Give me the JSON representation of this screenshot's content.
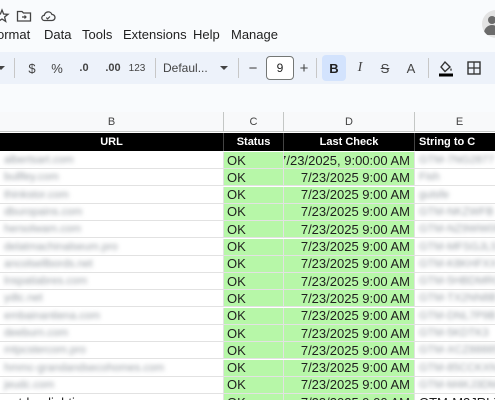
{
  "menu": {
    "items": [
      "ormat",
      "Data",
      "Tools",
      "Extensions",
      "Help",
      "Manage"
    ]
  },
  "toolbar": {
    "currency": "$",
    "percent": "%",
    "decrease_decimal": ".0",
    "increase_decimal": ".00",
    "number_format": "123",
    "font_name": "Defaul...",
    "font_size": "9",
    "minus": "−",
    "plus": "+",
    "bold": "B",
    "italic": "I",
    "strike": "S",
    "text_color": "A"
  },
  "columns": {
    "B": "B",
    "C": "C",
    "D": "D",
    "E": "E"
  },
  "header_row": {
    "url": "URL",
    "status": "Status",
    "last_check": "Last Check",
    "string_to": "String to C"
  },
  "rows": [
    {
      "url": "albertsart.com",
      "status": "OK",
      "last_check": "7/23/2025, 9:00:00 AM",
      "string": "GTM-7NG2877"
    },
    {
      "url": "bullfey.com",
      "status": "OK",
      "last_check": "7/23/2025 9:00 AM",
      "string": "Fish"
    },
    {
      "url": "thinkstor.com",
      "status": "OK",
      "last_check": "7/23/2025 9:00 AM",
      "string": "gutsfe"
    },
    {
      "url": "dburopains.com",
      "status": "OK",
      "last_check": "7/23/2025 9:00 AM",
      "string": "GTM-NKZWFB"
    },
    {
      "url": "hersolwam.com",
      "status": "OK",
      "last_check": "7/23/2025 9:00 AM",
      "string": "GTM-NZ9WW09"
    },
    {
      "url": "delatmachinalseum.pro",
      "status": "OK",
      "last_check": "7/23/2025 9:00 AM",
      "string": "GTM-MFSGJLS"
    },
    {
      "url": "ancolsellbords.net",
      "status": "OK",
      "last_check": "7/23/2025 9:00 AM",
      "string": "GTM-K8KHFXX"
    },
    {
      "url": "lnspatiabres.com",
      "status": "OK",
      "last_check": "7/23/2025 9:00 AM",
      "string": "GTM-5HBDMRC"
    },
    {
      "url": "ydtc.net",
      "status": "OK",
      "last_check": "7/23/2025 9:00 AM",
      "string": "GTM-TX2NN8B"
    },
    {
      "url": "embainantiena.com",
      "status": "OK",
      "last_check": "7/23/2025 9:00 AM",
      "string": "GTM-DNL7P9B"
    },
    {
      "url": "deeburn.com",
      "status": "OK",
      "last_check": "7/23/2025 9:00 AM",
      "string": "GTM-5KDTK3"
    },
    {
      "url": "mtpcstercom.pro",
      "status": "OK",
      "last_check": "7/23/2025 9:00 AM",
      "string": "GTM-XCZ88885"
    },
    {
      "url": "hmmc-grandandsecohomes.com",
      "status": "OK",
      "last_check": "7/23/2025 9:00 AM",
      "string": "GTM-85CCKXN"
    },
    {
      "url": "jeudc.com",
      "status": "OK",
      "last_check": "7/23/2025 9:00 AM",
      "string": "GTM-M4KJ3DMR"
    },
    {
      "url": "outdoorlighting.com",
      "status": "OK",
      "last_check": "7/23/2025 9:00 AM",
      "string": "GTM-M2JRLX9"
    }
  ],
  "colors": {
    "ok_green": "#b7f7a8",
    "header_black": "#000000",
    "toolbar_bg": "#edf2fa",
    "bold_active": "#d3e3fd"
  }
}
